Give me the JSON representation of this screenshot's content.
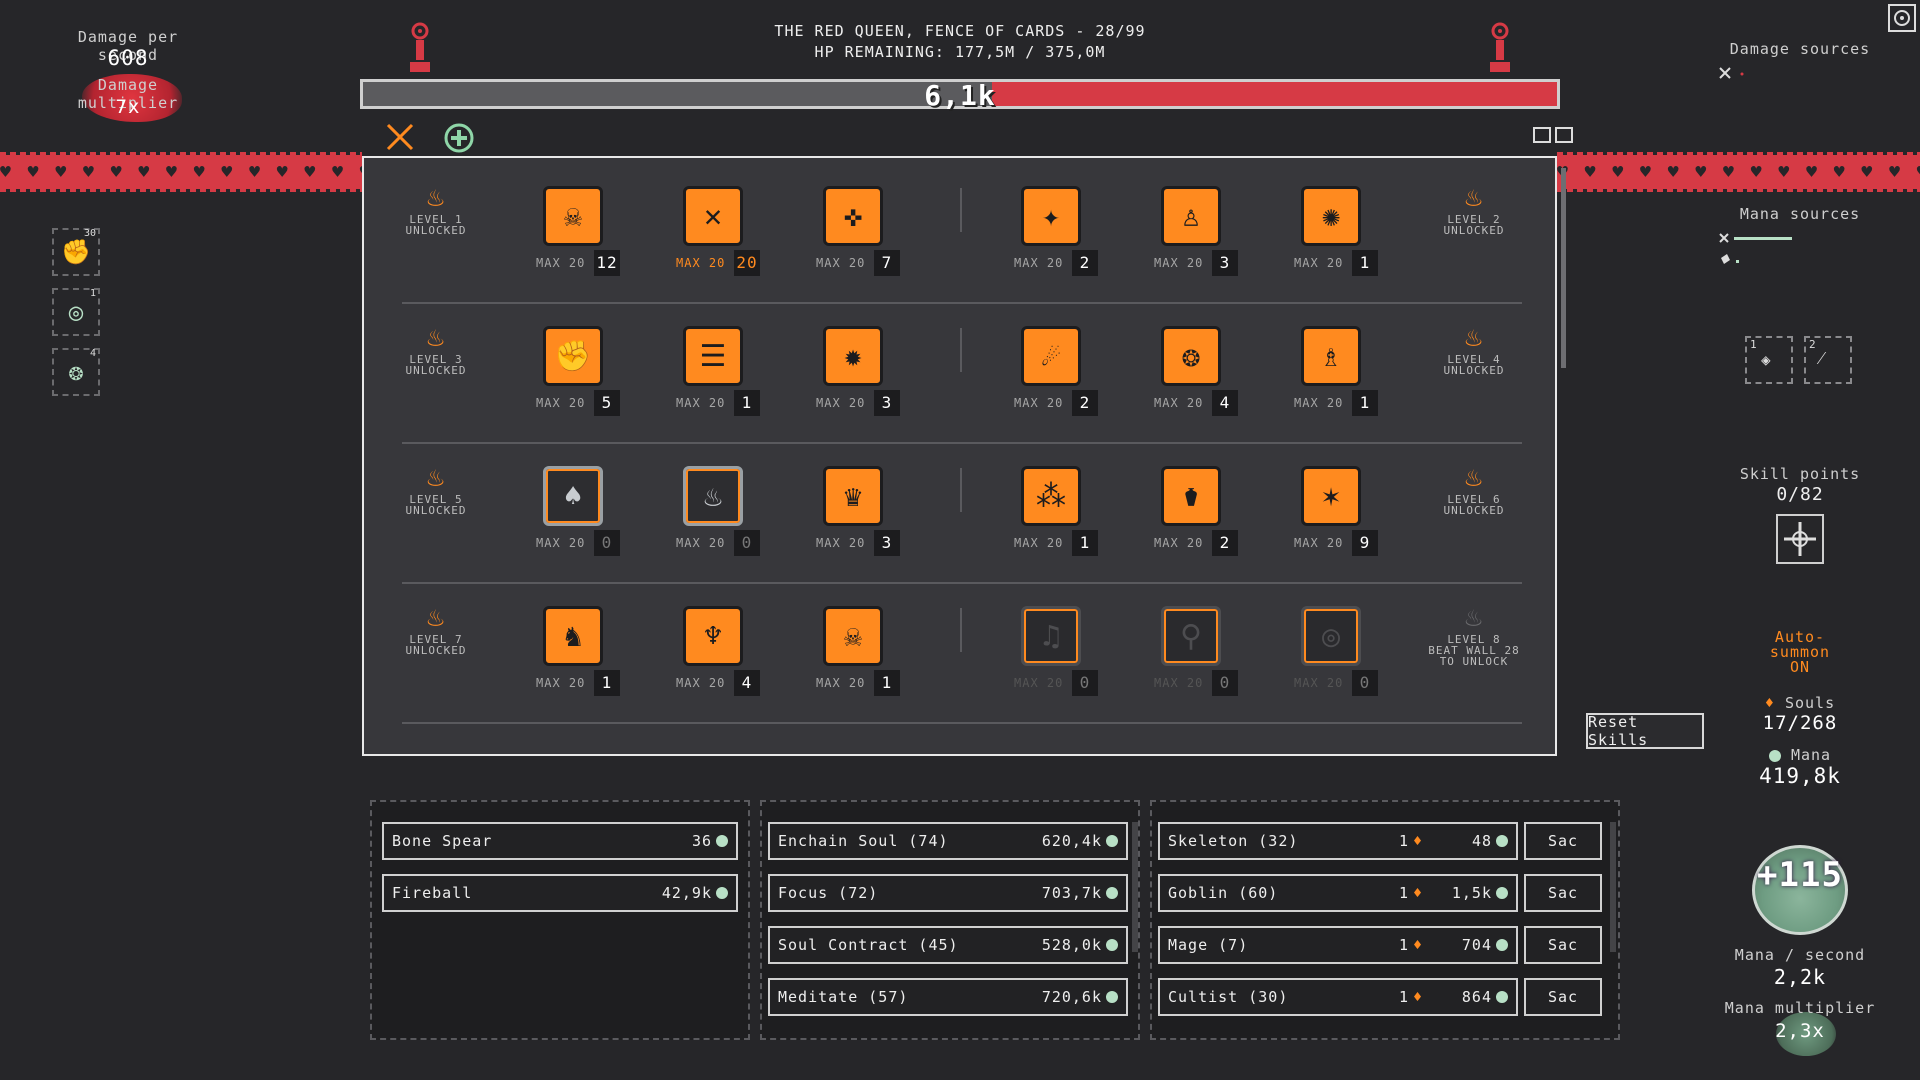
{
  "stats": {
    "dps_label": "Damage per second",
    "dps_value": "608",
    "damage_multiplier_label": "Damage multiplier",
    "damage_multiplier_value": "7x"
  },
  "boss": {
    "title": "THE RED QUEEN, FENCE OF CARDS - 28/99",
    "hp_text": "HP REMAINING: 177,5M / 375,0M",
    "damage_popup": "6,1k",
    "hp_fraction": 0.473
  },
  "right": {
    "damage_sources_label": "Damage sources",
    "mana_sources_label": "Mana sources",
    "skill_points_label": "Skill points",
    "skill_points_value": "0/82",
    "auto_summon": [
      "Auto-",
      "summon",
      "ON"
    ],
    "souls_label": "Souls",
    "souls_value": "17/268",
    "mana_label": "Mana",
    "mana_value": "419,8k",
    "orb_value": "+115",
    "mana_per_second_label": "Mana / second",
    "mana_per_second_value": "2,2k",
    "mana_multiplier_label": "Mana multiplier",
    "mana_multiplier_value": "2,3x",
    "slot_numbers": [
      "1",
      "2"
    ]
  },
  "side_buttons": [
    {
      "icon": "fist-icon",
      "badge": "30"
    },
    {
      "icon": "target-icon",
      "badge": "1"
    },
    {
      "icon": "brain-icon",
      "badge": "4"
    }
  ],
  "skill_rows": [
    {
      "left_level": [
        "LEVEL 1",
        "UNLOCKED"
      ],
      "right_level": [
        "LEVEL 2",
        "UNLOCKED"
      ],
      "skills": [
        {
          "icon": "skull-icon",
          "glyph": "☠",
          "max": "MAX 20",
          "count": "12",
          "state": "active"
        },
        {
          "icon": "crossed-arrows-icon",
          "glyph": "✕",
          "max": "MAX 20",
          "count": "20",
          "state": "maxed"
        },
        {
          "icon": "converge-arrows-icon",
          "glyph": "✜",
          "max": "MAX 20",
          "count": "7",
          "state": "active"
        },
        {
          "icon": "spark-figure-icon",
          "glyph": "✦",
          "max": "MAX 20",
          "count": "2",
          "state": "active"
        },
        {
          "icon": "hooded-figure-icon",
          "glyph": "♙",
          "max": "MAX 20",
          "count": "3",
          "state": "active"
        },
        {
          "icon": "sun-gear-icon",
          "glyph": "✺",
          "max": "MAX 20",
          "count": "1",
          "state": "active"
        }
      ]
    },
    {
      "left_level": [
        "LEVEL 3",
        "UNLOCKED"
      ],
      "right_level": [
        "LEVEL 4",
        "UNLOCKED"
      ],
      "skills": [
        {
          "icon": "fist-icon",
          "glyph": "✊",
          "max": "MAX 20",
          "count": "5",
          "state": "active"
        },
        {
          "icon": "scroll-icon",
          "glyph": "☰",
          "max": "MAX 20",
          "count": "1",
          "state": "active"
        },
        {
          "icon": "vortex-icon",
          "glyph": "✹",
          "max": "MAX 20",
          "count": "3",
          "state": "active"
        },
        {
          "icon": "comet-icon",
          "glyph": "☄",
          "max": "MAX 20",
          "count": "2",
          "state": "active"
        },
        {
          "icon": "brain-icon",
          "glyph": "❂",
          "max": "MAX 20",
          "count": "4",
          "state": "active"
        },
        {
          "icon": "wizard-icon",
          "glyph": "♗",
          "max": "MAX 20",
          "count": "1",
          "state": "active"
        }
      ]
    },
    {
      "left_level": [
        "LEVEL 5",
        "UNLOCKED"
      ],
      "right_level": [
        "LEVEL 6",
        "UNLOCKED"
      ],
      "skills": [
        {
          "icon": "blood-drop-sword-icon",
          "glyph": "♠",
          "max": "MAX 20",
          "count": "0",
          "state": "gray"
        },
        {
          "icon": "fire-field-icon",
          "glyph": "♨",
          "max": "MAX 20",
          "count": "0",
          "state": "gray"
        },
        {
          "icon": "crowned-skull-icon",
          "glyph": "♛",
          "max": "MAX 20",
          "count": "3",
          "state": "active"
        },
        {
          "icon": "drops-icon",
          "glyph": "⁂",
          "max": "MAX 20",
          "count": "1",
          "state": "active"
        },
        {
          "icon": "urns-icon",
          "glyph": "⚱",
          "max": "MAX 20",
          "count": "2",
          "state": "active"
        },
        {
          "icon": "bone-pile-icon",
          "glyph": "✶",
          "max": "MAX 20",
          "count": "9",
          "state": "active"
        }
      ]
    },
    {
      "left_level": [
        "LEVEL 7",
        "UNLOCKED"
      ],
      "right_level": [
        "LEVEL 8",
        "BEAT WALL 28",
        "TO UNLOCK"
      ],
      "right_locked": true,
      "skills": [
        {
          "icon": "camel-icon",
          "glyph": "♞",
          "max": "MAX 20",
          "count": "1",
          "state": "active"
        },
        {
          "icon": "bat-icon",
          "glyph": "♆",
          "max": "MAX 20",
          "count": "4",
          "state": "active"
        },
        {
          "icon": "radiant-skull-icon",
          "glyph": "☠",
          "max": "MAX 20",
          "count": "1",
          "state": "active"
        },
        {
          "icon": "music-note-icon",
          "glyph": "♫",
          "max": "MAX 20",
          "count": "0",
          "state": "locked"
        },
        {
          "icon": "mortar-pestle-icon",
          "glyph": "⚲",
          "max": "MAX 20",
          "count": "0",
          "state": "locked"
        },
        {
          "icon": "crystal-ball-icon",
          "glyph": "◎",
          "max": "MAX 20",
          "count": "0",
          "state": "locked"
        }
      ]
    }
  ],
  "reset_label": "Reset Skills",
  "spells": [
    {
      "name": "Bone Spear",
      "cost": "36"
    },
    {
      "name": "Fireball",
      "cost": "42,9k"
    }
  ],
  "upgrades": [
    {
      "name": "Enchain Soul (74)",
      "cost": "620,4k"
    },
    {
      "name": "Focus (72)",
      "cost": "703,7k"
    },
    {
      "name": "Soul Contract (45)",
      "cost": "528,0k"
    },
    {
      "name": "Meditate (57)",
      "cost": "720,6k"
    }
  ],
  "summons": [
    {
      "name": "Skeleton (32)",
      "souls": "1",
      "mana": "48",
      "sac": "Sac"
    },
    {
      "name": "Goblin (60)",
      "souls": "1",
      "mana": "1,5k",
      "sac": "Sac"
    },
    {
      "name": "Mage (7)",
      "souls": "1",
      "mana": "704",
      "sac": "Sac"
    },
    {
      "name": "Cultist (30)",
      "souls": "1",
      "mana": "864",
      "sac": "Sac"
    }
  ],
  "colors": {
    "accent": "#ff8a1f",
    "hp": "#d63a45",
    "mana": "#b8e0c6",
    "background": "#262629"
  }
}
